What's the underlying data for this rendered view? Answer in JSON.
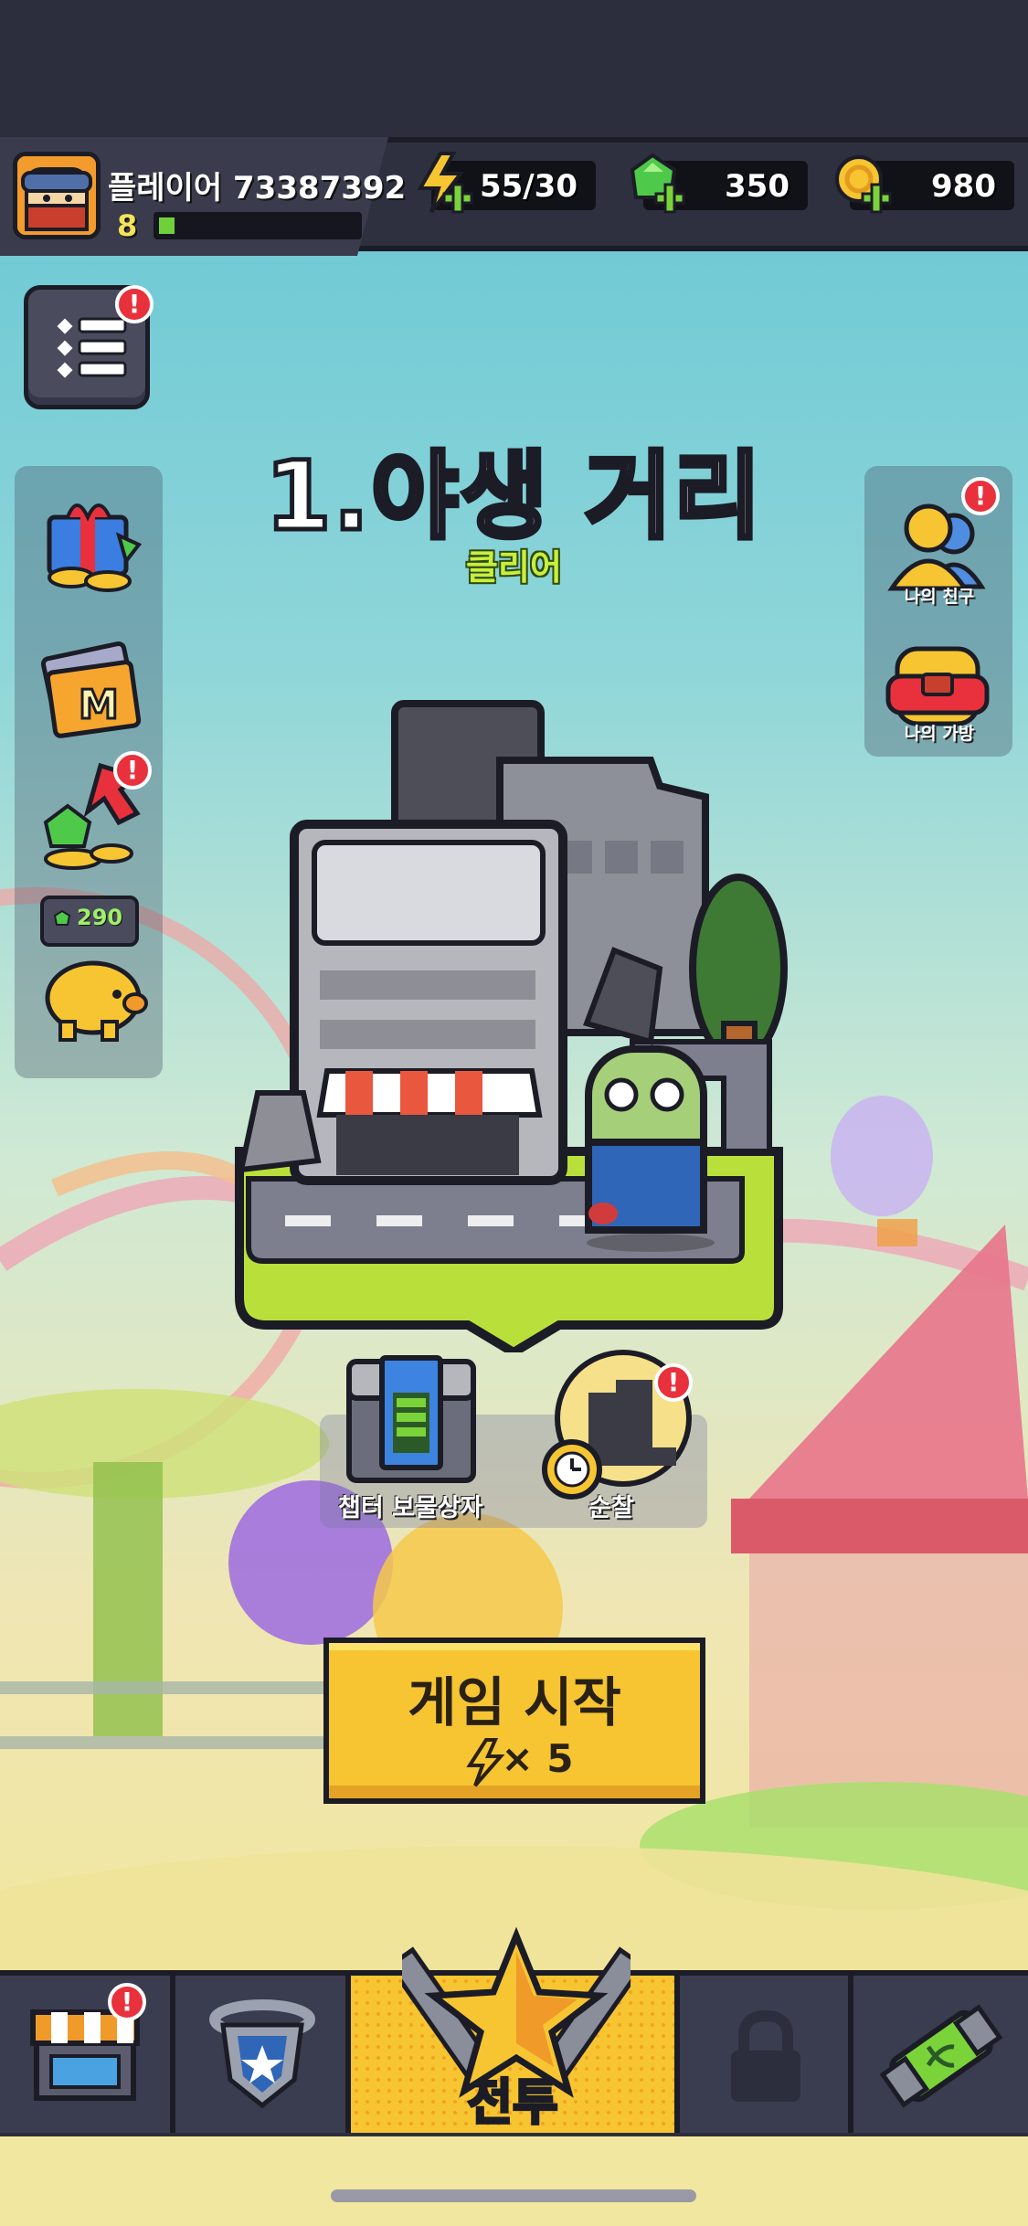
{
  "hud": {
    "player_name": "플레이어 73387392",
    "player_level": "8",
    "xp_fraction": 0.08,
    "energy": "55/30",
    "gems": "350",
    "coins": "980"
  },
  "menu": {
    "badge": "!"
  },
  "side_left": {
    "piggy_value": "290"
  },
  "side_right": {
    "friends_label": "나의 친구",
    "bag_label": "나의 가방"
  },
  "stage": {
    "title": "1.야생 거리",
    "status": "클리어"
  },
  "mini_buttons": {
    "chest_label": "챕터 보물상자",
    "patrol_label": "순찰"
  },
  "start_button": {
    "title": "게임 시작",
    "cost": "× 5"
  },
  "bottom_nav": {
    "battle_label": "전투"
  },
  "colors": {
    "accent_yellow": "#f6c531",
    "badge_red": "#e8313c",
    "clear_green": "#c8ef3d",
    "hud_dark": "#2e3040"
  },
  "icons": {
    "menu": "list-icon",
    "energy": "lightning-plus-icon",
    "gem": "green-gem-plus-icon",
    "coin": "gold-coin-plus-icon",
    "gift": "gift-box-icon",
    "ticket": "m-ticket-icon",
    "growth": "gem-arrow-icon",
    "piggy": "piggy-bank-icon",
    "friends": "friends-icon",
    "bag": "backpack-icon",
    "chest": "chapter-chest-icon",
    "patrol": "patrol-clock-icon",
    "shop": "shop-icon",
    "shield": "shield-star-icon",
    "battle": "battle-star-icon",
    "lock": "lock-icon",
    "dna": "dna-capsule-icon"
  }
}
